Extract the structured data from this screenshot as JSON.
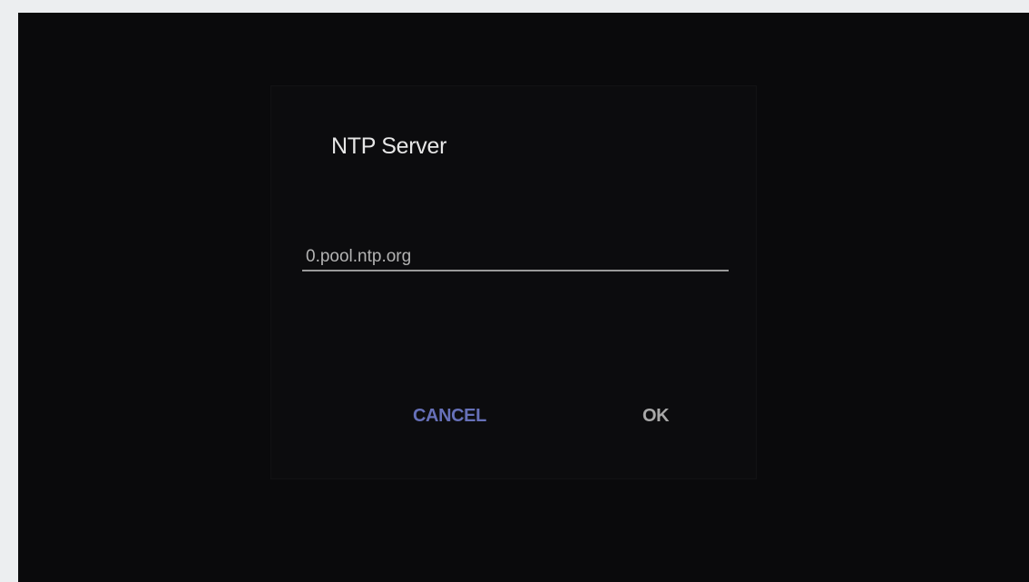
{
  "dialog": {
    "title": "NTP Server",
    "input_value": "0.pool.ntp.org",
    "cancel_label": "CANCEL",
    "ok_label": "OK"
  },
  "colors": {
    "screen_background": "#0a0a0c",
    "cancel_accent": "#6670b8",
    "ok_text": "#a8a8a8"
  }
}
